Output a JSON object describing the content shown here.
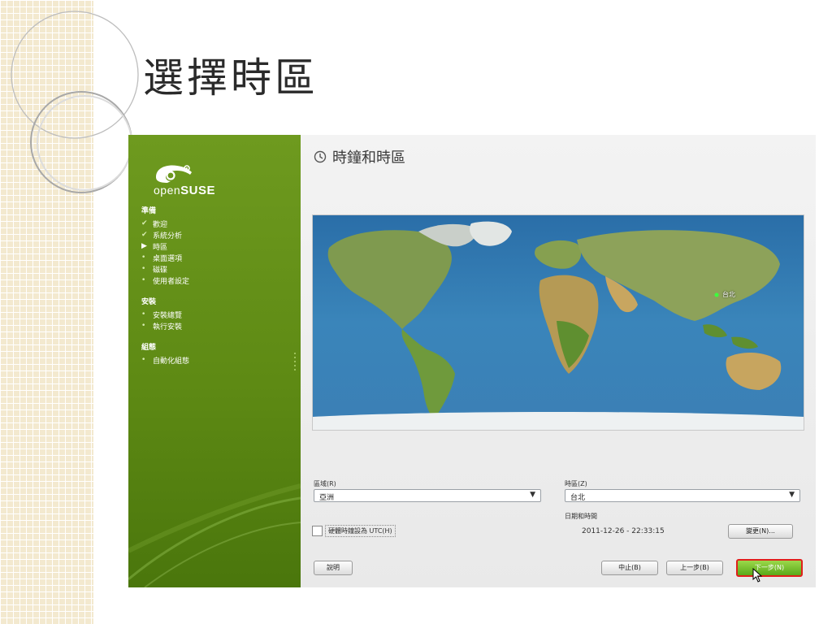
{
  "slide": {
    "title": "選擇時區"
  },
  "installer": {
    "logo_text_pre": "open",
    "logo_text_bold": "SUSE",
    "nav": [
      {
        "group": "準備",
        "items": [
          {
            "label": "歡迎",
            "state": "done"
          },
          {
            "label": "系統分析",
            "state": "done"
          },
          {
            "label": "時區",
            "state": "current"
          },
          {
            "label": "桌面選項",
            "state": "pending"
          },
          {
            "label": "磁碟",
            "state": "pending"
          },
          {
            "label": "使用者設定",
            "state": "pending"
          }
        ]
      },
      {
        "group": "安裝",
        "items": [
          {
            "label": "安裝總覽",
            "state": "pending"
          },
          {
            "label": "執行安裝",
            "state": "pending"
          }
        ]
      },
      {
        "group": "組態",
        "items": [
          {
            "label": "自動化組態",
            "state": "pending"
          }
        ]
      }
    ],
    "heading": "時鐘和時區",
    "map": {
      "marker_label": "台北"
    },
    "region": {
      "label": "區域(R)",
      "value": "亞洲"
    },
    "timezone": {
      "label": "時區(Z)",
      "value": "台北"
    },
    "datetime": {
      "label": "日期和時間",
      "value": "2011-12-26 - 22:33:15"
    },
    "utc_checkbox_label": "硬體時鐘設為 UTC(H)",
    "buttons": {
      "change": "變更(N)...",
      "help": "說明",
      "abort": "中止(B)",
      "back": "上一步(B)",
      "next": "下一步(N)"
    },
    "colors": {
      "sidebar_green": "#6e9a1f",
      "next_button_highlight": "#e0201b"
    }
  }
}
